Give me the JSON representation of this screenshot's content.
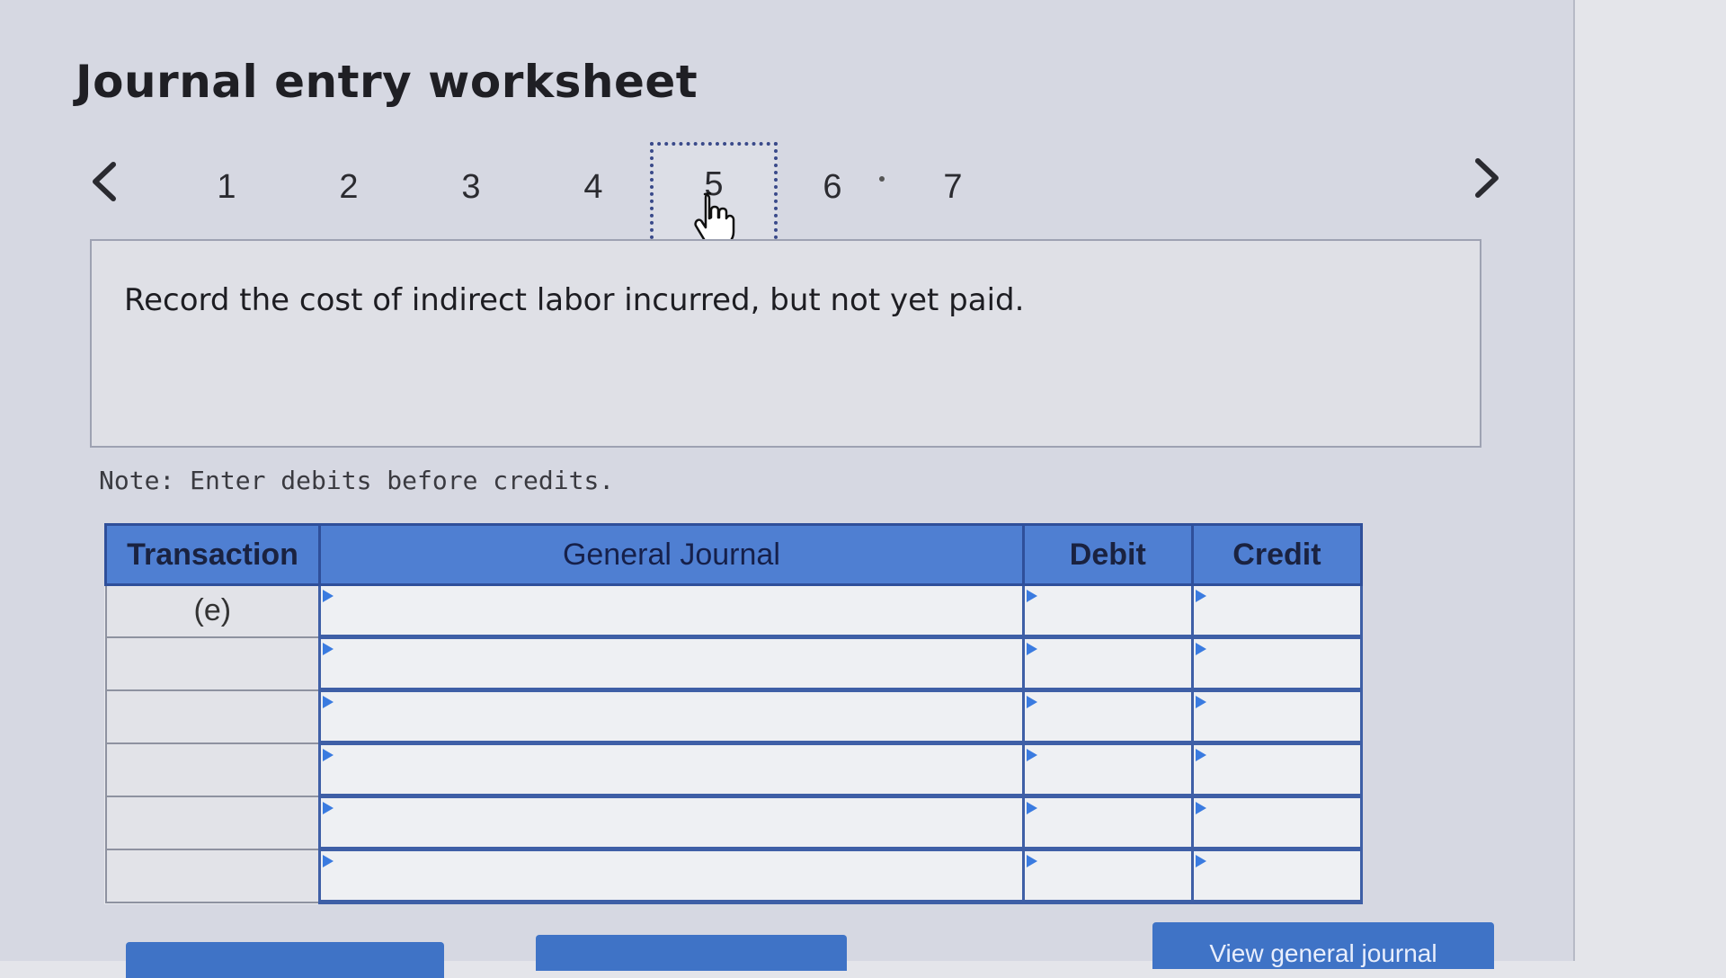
{
  "worksheet": {
    "title": "Journal entry worksheet",
    "pages": [
      "1",
      "2",
      "3",
      "4",
      "5",
      "6",
      "7"
    ],
    "active_page": "5",
    "instruction": "Record the cost of indirect labor incurred, but not yet paid.",
    "note": "Note: Enter debits before credits."
  },
  "table": {
    "headers": {
      "transaction": "Transaction",
      "general_journal": "General Journal",
      "debit": "Debit",
      "credit": "Credit"
    },
    "rows": [
      {
        "transaction": "(e)",
        "account": "",
        "debit": "",
        "credit": ""
      },
      {
        "transaction": "",
        "account": "",
        "debit": "",
        "credit": ""
      },
      {
        "transaction": "",
        "account": "",
        "debit": "",
        "credit": ""
      },
      {
        "transaction": "",
        "account": "",
        "debit": "",
        "credit": ""
      },
      {
        "transaction": "",
        "account": "",
        "debit": "",
        "credit": ""
      },
      {
        "transaction": "",
        "account": "",
        "debit": "",
        "credit": ""
      }
    ]
  },
  "buttons": {
    "left_label": "",
    "middle_label": "",
    "view_journal_label": "View general journal"
  },
  "icons": {
    "prev": "chevron-left-icon",
    "next": "chevron-right-icon",
    "cursor": "hand-pointer-icon"
  },
  "colors": {
    "header_blue": "#4f7fd2",
    "grid_blue": "#3e5fa6",
    "button_blue": "#3f73c6"
  }
}
